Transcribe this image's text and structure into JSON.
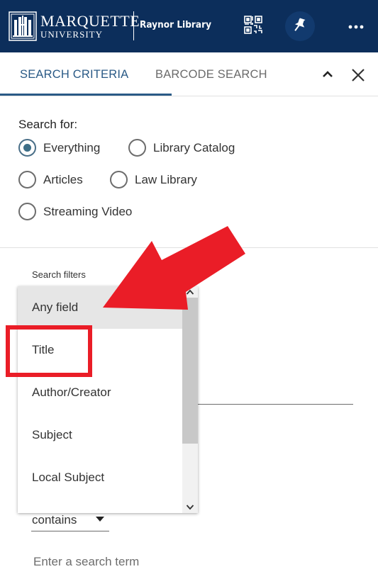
{
  "header": {
    "logo_text_line1": "MARQUETTE",
    "logo_text_line2": "UNIVERSITY",
    "library_name": "Raynor Library",
    "background_color": "#0c2e5b",
    "icons": [
      "marquette-seal-icon",
      "qr-code-icon",
      "pin-icon",
      "more-dots-icon"
    ]
  },
  "tabs": [
    {
      "label": "SEARCH CRITERIA",
      "active": true
    },
    {
      "label": "BARCODE SEARCH",
      "active": false
    }
  ],
  "tab_controls": [
    "chevron-up-icon",
    "close-icon"
  ],
  "search_for": {
    "label": "Search for:",
    "options": [
      {
        "label": "Everything",
        "selected": true
      },
      {
        "label": "Library Catalog",
        "selected": false
      },
      {
        "label": "Articles",
        "selected": false
      },
      {
        "label": "Law Library",
        "selected": false
      },
      {
        "label": "Streaming Video",
        "selected": false
      }
    ]
  },
  "filters": {
    "label": "Search filters",
    "dropdown_options": [
      {
        "label": "Any field",
        "highlighted": true
      },
      {
        "label": "Title",
        "highlighted": false
      },
      {
        "label": "Author/Creator",
        "highlighted": false
      },
      {
        "label": "Subject",
        "highlighted": false
      },
      {
        "label": "Local Subject",
        "highlighted": false
      }
    ],
    "operator_value": "contains",
    "search_term_placeholder": "Enter a search term"
  },
  "annotations": {
    "highlight_color": "#ea1d27"
  }
}
